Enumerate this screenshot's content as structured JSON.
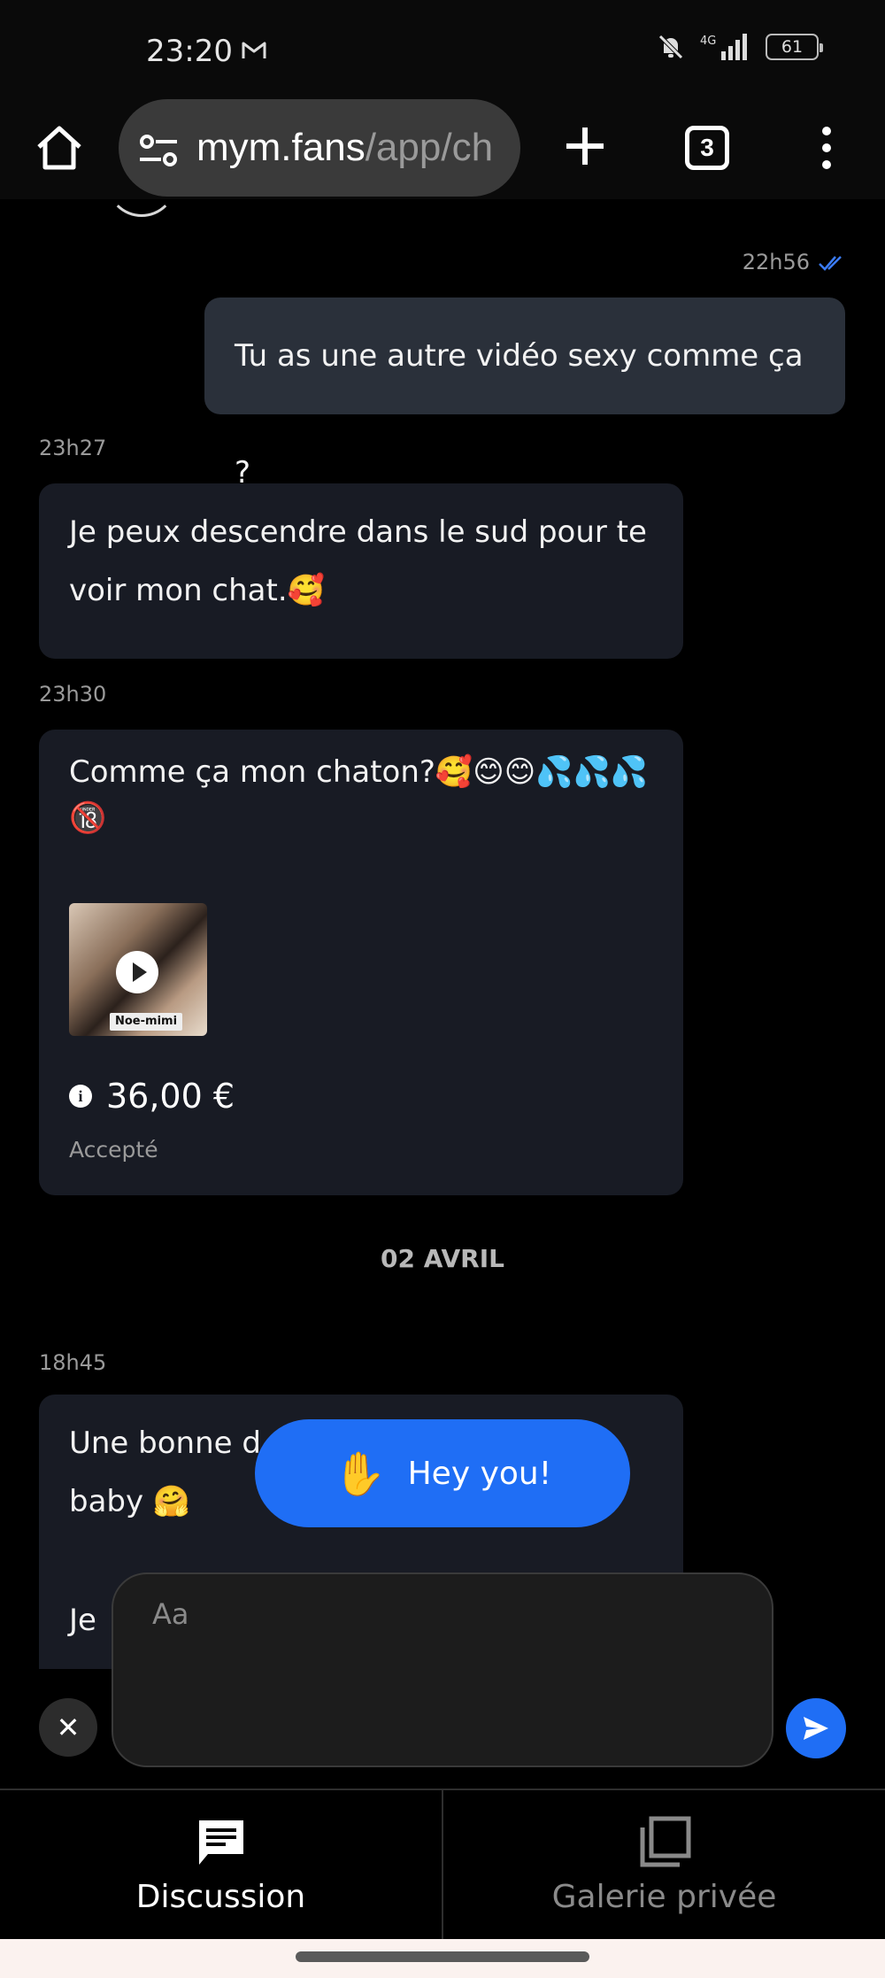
{
  "status_bar": {
    "time": "23:20",
    "network": "4G",
    "battery": "61"
  },
  "browser": {
    "url_host": "mym.fans",
    "url_path": "/app/ch",
    "tab_count": "3"
  },
  "chat": {
    "messages": [
      {
        "direction": "out",
        "time": "22h56",
        "text": "Tu as une autre vidéo sexy comme ça ?"
      },
      {
        "direction": "in",
        "time": "23h27",
        "text_line1": "Je peux descendre dans le sud pour te",
        "text_line2": "voir mon chat.🥰"
      },
      {
        "direction": "in",
        "time": "23h30",
        "text_line1": "Comme ça mon chaton?🥰😊😊💦💦💦",
        "text_line2": "🔞",
        "media_tag": "Noe-mimi",
        "price": "36,00 €",
        "status": "Accepté"
      },
      {
        "direction": "in",
        "time": "18h45",
        "text_line1": "Une bonne d",
        "text_line2": "baby 🤗",
        "text_line3": "Je"
      }
    ],
    "day_separator": "02 AVRIL",
    "hey_button": "Hey you!",
    "hey_emoji": "✋"
  },
  "composer": {
    "placeholder": "Aa",
    "value": ""
  },
  "bottom_nav": {
    "items": [
      {
        "label": "Discussion",
        "active": true
      },
      {
        "label": "Galerie privée",
        "active": false
      }
    ]
  },
  "colors": {
    "accent": "#1f6ef5",
    "bubble_in": "#181b24",
    "bubble_out": "#2a303a"
  }
}
